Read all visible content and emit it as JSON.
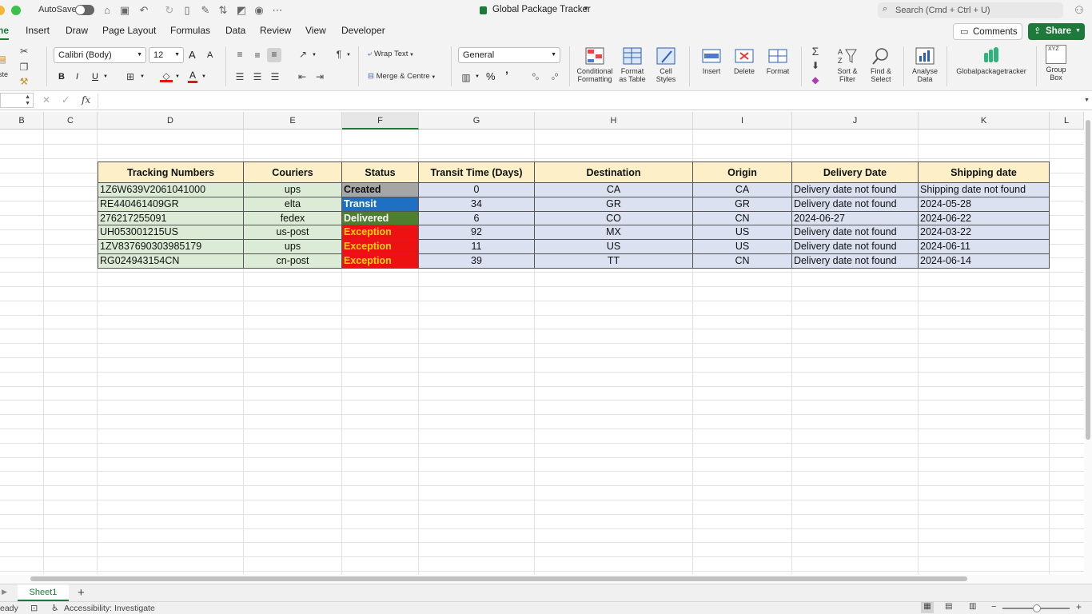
{
  "titlebar": {
    "autosave_label": "AutoSave",
    "doc_title": "Global Package Tracker",
    "search_placeholder": "Search (Cmd + Ctrl + U)"
  },
  "tabs": [
    "ne",
    "Insert",
    "Draw",
    "Page Layout",
    "Formulas",
    "Data",
    "Review",
    "View",
    "Developer"
  ],
  "actions": {
    "comments": "Comments",
    "share": "Share"
  },
  "ribbon": {
    "font_name": "Calibri (Body)",
    "font_size": "12",
    "wrap_text": "Wrap Text",
    "merge_centre": "Merge & Centre",
    "number_format": "General",
    "paste_label": "ste",
    "bold": "B",
    "italic": "I",
    "underline": "U",
    "grow_font": "A",
    "shrink_font": "A",
    "font_color_glyph": "A",
    "percent": "%",
    "comma": "’",
    "conditional_formatting": [
      "Conditional",
      "Formatting"
    ],
    "format_as_table": [
      "Format",
      "as Table"
    ],
    "cell_styles": [
      "Cell",
      "Styles"
    ],
    "insert": "Insert",
    "delete": "Delete",
    "format": "Format",
    "sort_filter": [
      "Sort &",
      "Filter"
    ],
    "find_select": [
      "Find &",
      "Select"
    ],
    "analyse_data": [
      "Analyse",
      "Data"
    ],
    "addin": "Globalpackagetracker",
    "group_box": [
      "Group",
      "Box"
    ],
    "group_box_glyph": "XYZ"
  },
  "formula_bar": {
    "fx": "fx",
    "value": ""
  },
  "columns": [
    "B",
    "C",
    "D",
    "E",
    "F",
    "G",
    "H",
    "I",
    "J",
    "K",
    "L"
  ],
  "table": {
    "headers": [
      "Tracking Numbers",
      "Couriers",
      "Status",
      "Transit Time (Days)",
      "Destination",
      "Origin",
      "Delivery Date",
      "Shipping date"
    ],
    "rows": [
      [
        "1Z6W639V2061041000",
        "ups",
        "Created",
        "0",
        "CA",
        "CA",
        "Delivery date not found",
        "Shipping date not found"
      ],
      [
        "RE440461409GR",
        "elta",
        "Transit",
        "34",
        "GR",
        "GR",
        "Delivery date not found",
        "2024-05-28"
      ],
      [
        "276217255091",
        "fedex",
        "Delivered",
        "6",
        "CO",
        "CN",
        "2024-06-27",
        "2024-06-22"
      ],
      [
        "UH053001215US",
        "us-post",
        "Exception",
        "92",
        "MX",
        "US",
        "Delivery date not found",
        "2024-03-22"
      ],
      [
        "1ZV837690303985179",
        "ups",
        "Exception",
        "11",
        "US",
        "US",
        "Delivery date not found",
        "2024-06-11"
      ],
      [
        "RG024943154CN",
        "cn-post",
        "Exception",
        "39",
        "TT",
        "CN",
        "Delivery date not found",
        "2024-06-14"
      ]
    ]
  },
  "status_colors": {
    "Created": {
      "bg": "#a6a6a6",
      "fg": "#111111"
    },
    "Transit": {
      "bg": "#1f6fc2",
      "fg": "#ffffff"
    },
    "Delivered": {
      "bg": "#4e7f2e",
      "fg": "#ffffff"
    },
    "Exception": {
      "bg": "#ee1111",
      "fg": "#ffd800"
    }
  },
  "colors": {
    "header_fill": "#fdf0c8",
    "tracking_fill": "#dcebd5",
    "data_fill": "#dbe1f1",
    "share_green": "#1d7a3a"
  },
  "sheet_tabs": {
    "active": "Sheet1",
    "add": "+"
  },
  "statusbar": {
    "ready": "eady",
    "accessibility": "Accessibility: Investigate"
  }
}
